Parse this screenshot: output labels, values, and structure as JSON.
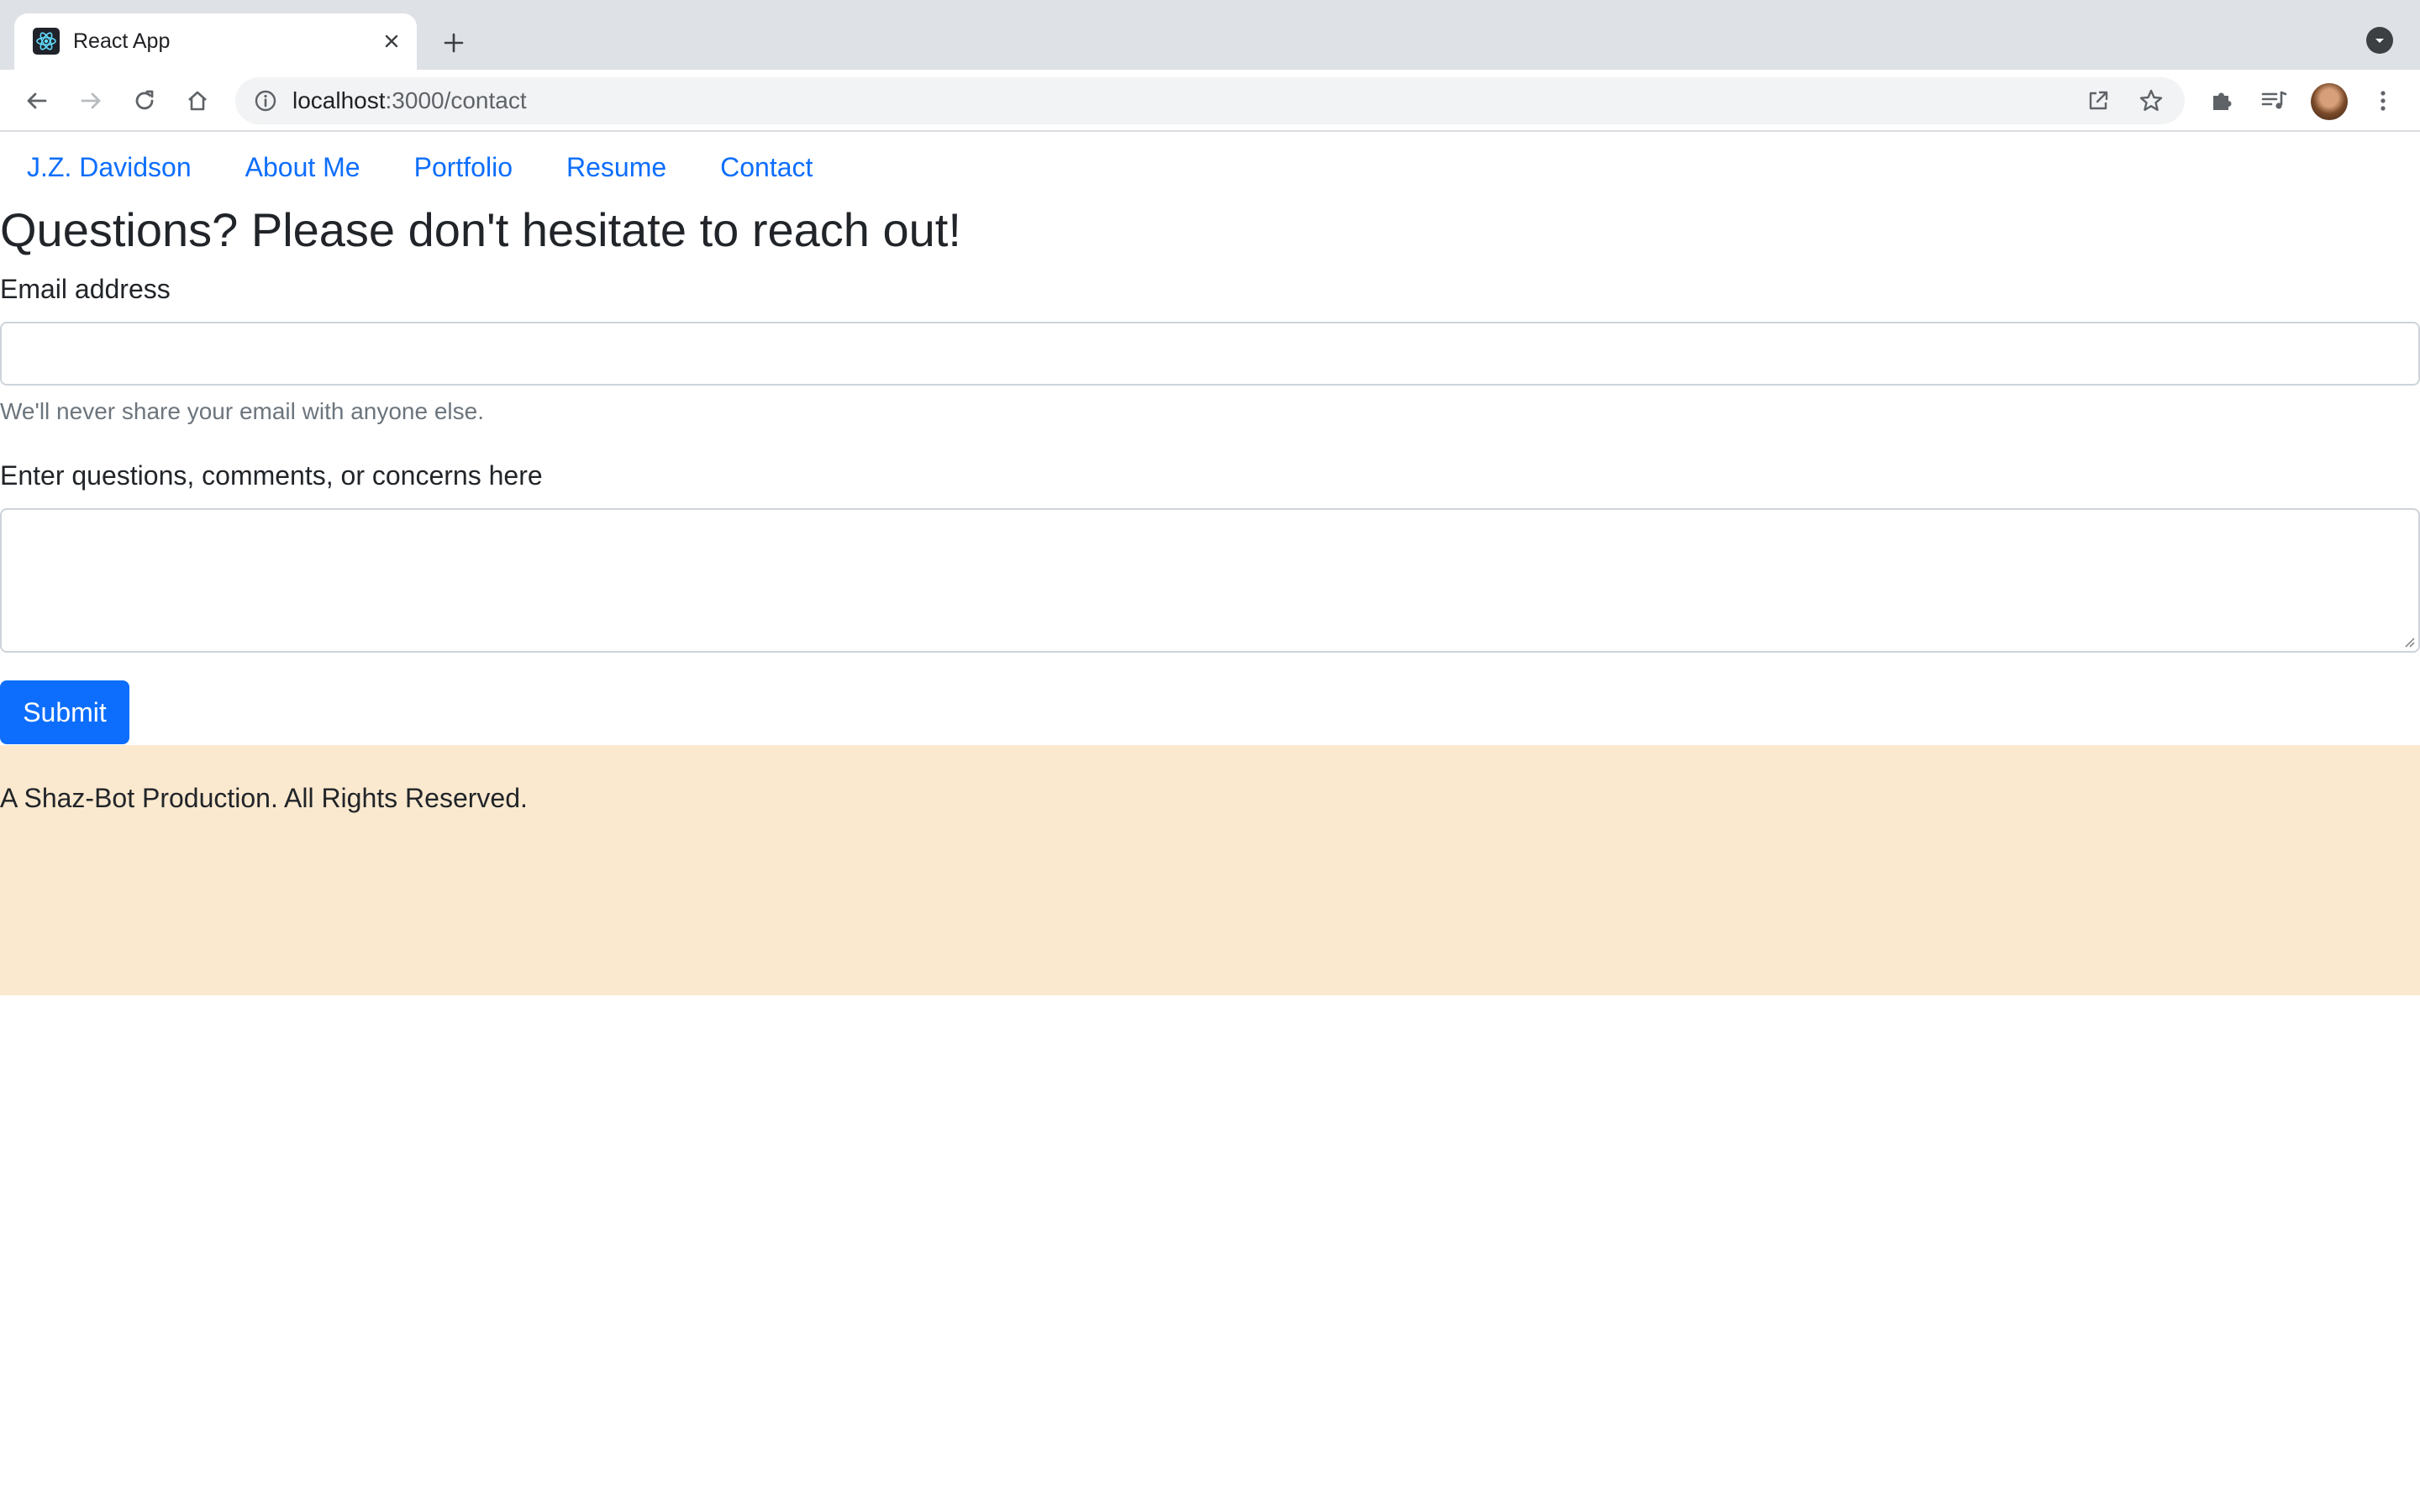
{
  "browser": {
    "tab": {
      "title": "React App",
      "favicon": "react-logo-icon"
    },
    "address_bar": {
      "host": "localhost",
      "path": ":3000/contact"
    },
    "icons": {
      "back": "arrow-left-icon",
      "forward": "arrow-right-icon",
      "reload": "reload-icon",
      "home": "home-icon",
      "info": "info-icon",
      "open_in_new": "open-external-icon",
      "bookmark": "star-icon",
      "extensions": "puzzle-icon",
      "media": "media-queue-icon",
      "menu": "kebab-menu-icon"
    }
  },
  "nav": {
    "items": [
      {
        "label": "J.Z. Davidson"
      },
      {
        "label": "About Me"
      },
      {
        "label": "Portfolio"
      },
      {
        "label": "Resume"
      },
      {
        "label": "Contact"
      }
    ]
  },
  "contact": {
    "heading": "Questions? Please don't hesitate to reach out!",
    "email_label": "Email address",
    "email_value": "",
    "email_help": "We'll never share your email with anyone else.",
    "message_label": "Enter questions, comments, or concerns here",
    "message_value": "",
    "submit_label": "Submit"
  },
  "footer": {
    "text": "A Shaz-Bot Production. All Rights Reserved."
  },
  "colors": {
    "link": "#0d6efd",
    "primary_button": "#0d6efd",
    "footer_bg": "#fbe9cf",
    "text": "#212529",
    "muted": "#6c757d"
  }
}
